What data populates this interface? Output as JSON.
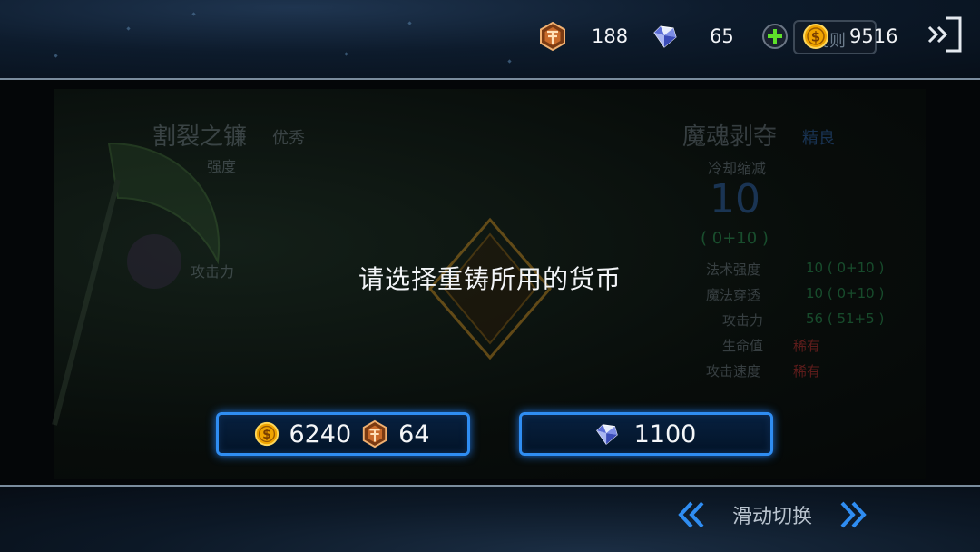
{
  "header": {
    "crystal_amount": "188",
    "diamond_amount": "65",
    "gold_amount": "9516",
    "rules_label": "规则"
  },
  "background_panel": {
    "left_title": "割裂之镰",
    "left_quality": "优秀",
    "left_stat_label": "强度",
    "left_attack_label": "攻击力",
    "right_title": "魔魂剥夺",
    "right_quality": "精良",
    "right_stat_label": "冷却缩减",
    "right_big_value": "10",
    "right_sub_value": "( 0+10 )",
    "right_stats": [
      {
        "label": "法术强度",
        "value": "10 ( 0+10 )"
      },
      {
        "label": "魔法穿透",
        "value": "10 ( 0+10 )"
      },
      {
        "label": "攻击力",
        "value": "56 ( 51+5 )"
      },
      {
        "label": "生命值",
        "value": "稀有"
      },
      {
        "label": "攻击速度",
        "value": "稀有"
      }
    ]
  },
  "dialog": {
    "prompt": "请选择重铸所用的货币",
    "option_gold": {
      "gold_cost": "6240",
      "crystal_cost": "64"
    },
    "option_diamond": {
      "diamond_cost": "1100"
    }
  },
  "footer": {
    "swipe_label": "滑动切换"
  },
  "colors": {
    "button_border": "#2f8df2",
    "gold_coin": "#f0a400",
    "crystal": "#c86a2a",
    "plus_green": "#5ee02a"
  }
}
